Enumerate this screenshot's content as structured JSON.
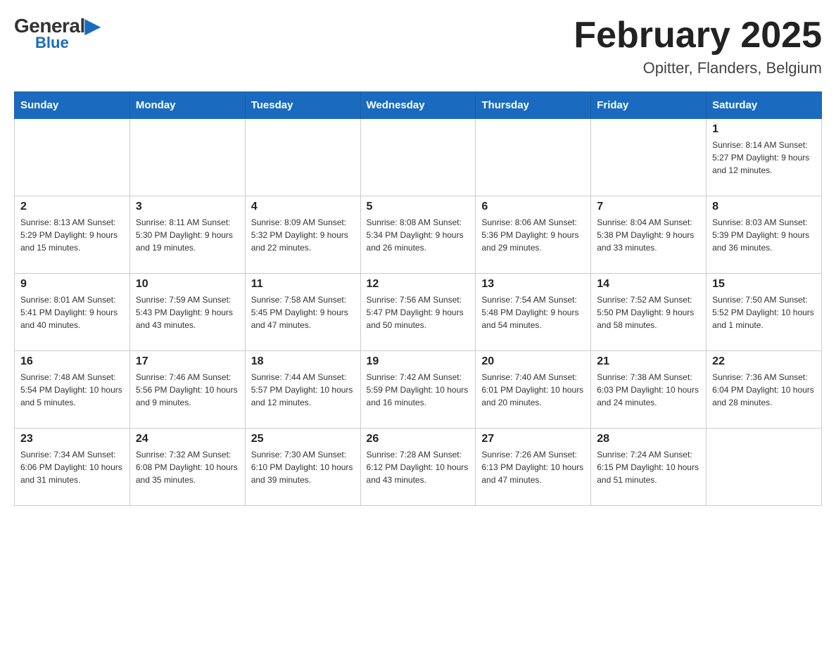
{
  "logo": {
    "general": "General",
    "triangle": "▶",
    "blue": "Blue"
  },
  "title": "February 2025",
  "subtitle": "Opitter, Flanders, Belgium",
  "weekdays": [
    "Sunday",
    "Monday",
    "Tuesday",
    "Wednesday",
    "Thursday",
    "Friday",
    "Saturday"
  ],
  "weeks": [
    [
      {
        "day": "",
        "info": ""
      },
      {
        "day": "",
        "info": ""
      },
      {
        "day": "",
        "info": ""
      },
      {
        "day": "",
        "info": ""
      },
      {
        "day": "",
        "info": ""
      },
      {
        "day": "",
        "info": ""
      },
      {
        "day": "1",
        "info": "Sunrise: 8:14 AM\nSunset: 5:27 PM\nDaylight: 9 hours and 12 minutes."
      }
    ],
    [
      {
        "day": "2",
        "info": "Sunrise: 8:13 AM\nSunset: 5:29 PM\nDaylight: 9 hours and 15 minutes."
      },
      {
        "day": "3",
        "info": "Sunrise: 8:11 AM\nSunset: 5:30 PM\nDaylight: 9 hours and 19 minutes."
      },
      {
        "day": "4",
        "info": "Sunrise: 8:09 AM\nSunset: 5:32 PM\nDaylight: 9 hours and 22 minutes."
      },
      {
        "day": "5",
        "info": "Sunrise: 8:08 AM\nSunset: 5:34 PM\nDaylight: 9 hours and 26 minutes."
      },
      {
        "day": "6",
        "info": "Sunrise: 8:06 AM\nSunset: 5:36 PM\nDaylight: 9 hours and 29 minutes."
      },
      {
        "day": "7",
        "info": "Sunrise: 8:04 AM\nSunset: 5:38 PM\nDaylight: 9 hours and 33 minutes."
      },
      {
        "day": "8",
        "info": "Sunrise: 8:03 AM\nSunset: 5:39 PM\nDaylight: 9 hours and 36 minutes."
      }
    ],
    [
      {
        "day": "9",
        "info": "Sunrise: 8:01 AM\nSunset: 5:41 PM\nDaylight: 9 hours and 40 minutes."
      },
      {
        "day": "10",
        "info": "Sunrise: 7:59 AM\nSunset: 5:43 PM\nDaylight: 9 hours and 43 minutes."
      },
      {
        "day": "11",
        "info": "Sunrise: 7:58 AM\nSunset: 5:45 PM\nDaylight: 9 hours and 47 minutes."
      },
      {
        "day": "12",
        "info": "Sunrise: 7:56 AM\nSunset: 5:47 PM\nDaylight: 9 hours and 50 minutes."
      },
      {
        "day": "13",
        "info": "Sunrise: 7:54 AM\nSunset: 5:48 PM\nDaylight: 9 hours and 54 minutes."
      },
      {
        "day": "14",
        "info": "Sunrise: 7:52 AM\nSunset: 5:50 PM\nDaylight: 9 hours and 58 minutes."
      },
      {
        "day": "15",
        "info": "Sunrise: 7:50 AM\nSunset: 5:52 PM\nDaylight: 10 hours and 1 minute."
      }
    ],
    [
      {
        "day": "16",
        "info": "Sunrise: 7:48 AM\nSunset: 5:54 PM\nDaylight: 10 hours and 5 minutes."
      },
      {
        "day": "17",
        "info": "Sunrise: 7:46 AM\nSunset: 5:56 PM\nDaylight: 10 hours and 9 minutes."
      },
      {
        "day": "18",
        "info": "Sunrise: 7:44 AM\nSunset: 5:57 PM\nDaylight: 10 hours and 12 minutes."
      },
      {
        "day": "19",
        "info": "Sunrise: 7:42 AM\nSunset: 5:59 PM\nDaylight: 10 hours and 16 minutes."
      },
      {
        "day": "20",
        "info": "Sunrise: 7:40 AM\nSunset: 6:01 PM\nDaylight: 10 hours and 20 minutes."
      },
      {
        "day": "21",
        "info": "Sunrise: 7:38 AM\nSunset: 6:03 PM\nDaylight: 10 hours and 24 minutes."
      },
      {
        "day": "22",
        "info": "Sunrise: 7:36 AM\nSunset: 6:04 PM\nDaylight: 10 hours and 28 minutes."
      }
    ],
    [
      {
        "day": "23",
        "info": "Sunrise: 7:34 AM\nSunset: 6:06 PM\nDaylight: 10 hours and 31 minutes."
      },
      {
        "day": "24",
        "info": "Sunrise: 7:32 AM\nSunset: 6:08 PM\nDaylight: 10 hours and 35 minutes."
      },
      {
        "day": "25",
        "info": "Sunrise: 7:30 AM\nSunset: 6:10 PM\nDaylight: 10 hours and 39 minutes."
      },
      {
        "day": "26",
        "info": "Sunrise: 7:28 AM\nSunset: 6:12 PM\nDaylight: 10 hours and 43 minutes."
      },
      {
        "day": "27",
        "info": "Sunrise: 7:26 AM\nSunset: 6:13 PM\nDaylight: 10 hours and 47 minutes."
      },
      {
        "day": "28",
        "info": "Sunrise: 7:24 AM\nSunset: 6:15 PM\nDaylight: 10 hours and 51 minutes."
      },
      {
        "day": "",
        "info": ""
      }
    ]
  ]
}
